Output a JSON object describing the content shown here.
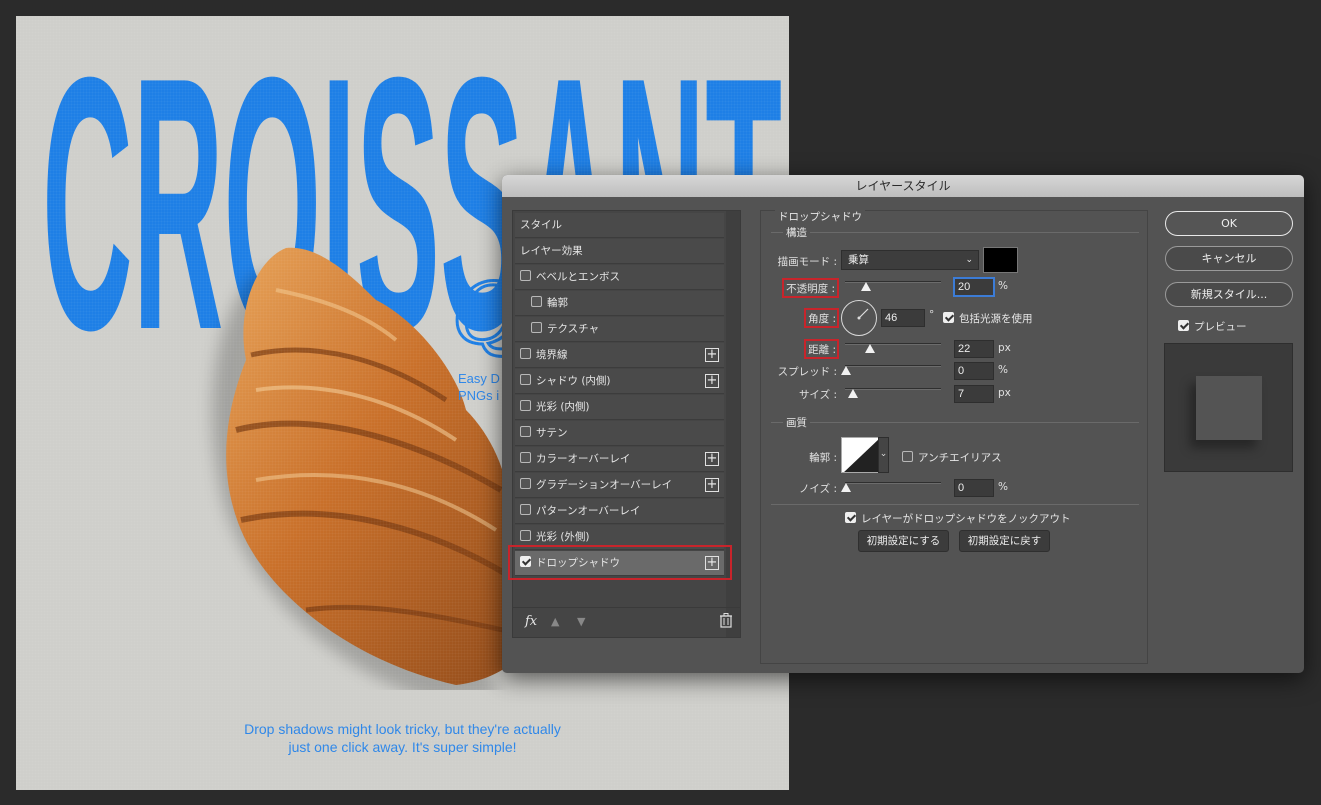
{
  "artwork": {
    "title_word": "CROISSANT",
    "script_letter": "Q",
    "side_text": [
      "Easy D",
      "PNGs i"
    ],
    "caption_lines": [
      "Drop shadows might look tricky, but they're actually",
      "just one click away. It's super simple!"
    ],
    "brand_blue": "#1e7fe6"
  },
  "dialog": {
    "title": "レイヤースタイル",
    "style_list": [
      {
        "label": "スタイル",
        "checkbox": false,
        "plus": false,
        "checked": false,
        "indent": false
      },
      {
        "label": "レイヤー効果",
        "checkbox": false,
        "plus": false,
        "checked": false,
        "indent": false
      },
      {
        "label": "ベベルとエンボス",
        "checkbox": true,
        "plus": false,
        "checked": false,
        "indent": false
      },
      {
        "label": "輪郭",
        "checkbox": true,
        "plus": false,
        "checked": false,
        "indent": true
      },
      {
        "label": "テクスチャ",
        "checkbox": true,
        "plus": false,
        "checked": false,
        "indent": true
      },
      {
        "label": "境界線",
        "checkbox": true,
        "plus": true,
        "checked": false,
        "indent": false
      },
      {
        "label": "シャドウ (内側)",
        "checkbox": true,
        "plus": true,
        "checked": false,
        "indent": false
      },
      {
        "label": "光彩 (内側)",
        "checkbox": true,
        "plus": false,
        "checked": false,
        "indent": false
      },
      {
        "label": "サテン",
        "checkbox": true,
        "plus": false,
        "checked": false,
        "indent": false
      },
      {
        "label": "カラーオーバーレイ",
        "checkbox": true,
        "plus": true,
        "checked": false,
        "indent": false
      },
      {
        "label": "グラデーションオーバーレイ",
        "checkbox": true,
        "plus": true,
        "checked": false,
        "indent": false
      },
      {
        "label": "パターンオーバーレイ",
        "checkbox": true,
        "plus": false,
        "checked": false,
        "indent": false
      },
      {
        "label": "光彩 (外側)",
        "checkbox": true,
        "plus": false,
        "checked": false,
        "indent": false
      },
      {
        "label": "ドロップシャドウ",
        "checkbox": true,
        "plus": true,
        "checked": true,
        "indent": false,
        "selected": true
      }
    ],
    "footer": {
      "fx": "fx",
      "up_icon": "arrow-up-icon",
      "down_icon": "arrow-down-icon",
      "trash_icon": "trash-icon"
    },
    "drop_shadow": {
      "section_title": "ドロップシャドウ",
      "structure_title": "構造",
      "blend_mode_label": "描画モード :",
      "blend_mode_value": "乗算",
      "shadow_color": "#000000",
      "opacity_label": "不透明度 :",
      "opacity_value": "20",
      "opacity_unit": "%",
      "angle_label": "角度 :",
      "angle_value": "46",
      "angle_unit": "°",
      "global_light_label": "包括光源を使用",
      "global_light_checked": true,
      "distance_label": "距離 :",
      "distance_value": "22",
      "distance_unit": "px",
      "spread_label": "スプレッド :",
      "spread_value": "0",
      "spread_unit": "%",
      "size_label": "サイズ :",
      "size_value": "7",
      "size_unit": "px",
      "quality_title": "画質",
      "contour_label": "輪郭 :",
      "antialias_label": "アンチエイリアス",
      "antialias_checked": false,
      "noise_label": "ノイズ :",
      "noise_value": "0",
      "noise_unit": "%",
      "knockout_label": "レイヤーがドロップシャドウをノックアウト",
      "knockout_checked": true,
      "make_default": "初期設定にする",
      "reset_default": "初期設定に戻す"
    },
    "buttons": {
      "ok": "OK",
      "cancel": "キャンセル",
      "new_style": "新規スタイル...",
      "preview_label": "プレビュー",
      "preview_checked": true
    },
    "highlight_color": "#c8242b"
  }
}
